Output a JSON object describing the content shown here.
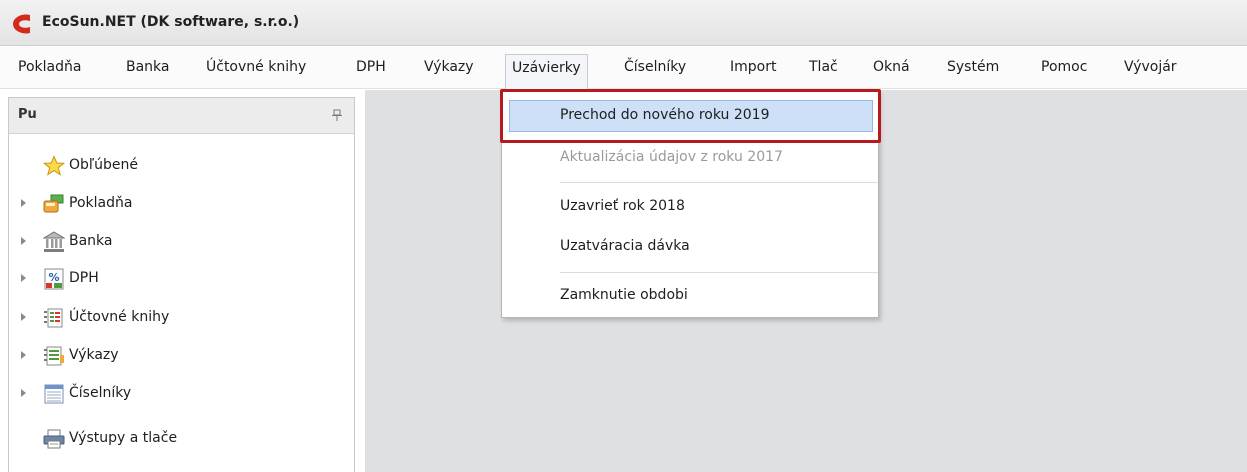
{
  "window": {
    "title": "EcoSun.NET  (DK software, s.r.o.)"
  },
  "menubar": {
    "items": [
      {
        "id": "pokladna",
        "label": "Pokladňa"
      },
      {
        "id": "banka",
        "label": "Banka"
      },
      {
        "id": "uctovne-knihy",
        "label": "Účtovné knihy"
      },
      {
        "id": "dph",
        "label": "DPH"
      },
      {
        "id": "vykazy",
        "label": "Výkazy"
      },
      {
        "id": "uzavierky",
        "label": "Uzávierky"
      },
      {
        "id": "ciselniky",
        "label": "Číselníky"
      },
      {
        "id": "import",
        "label": "Import"
      },
      {
        "id": "tlac",
        "label": "Tlač"
      },
      {
        "id": "okna",
        "label": "Okná"
      },
      {
        "id": "system",
        "label": "Systém"
      },
      {
        "id": "pomoc",
        "label": "Pomoc"
      },
      {
        "id": "vyvojar",
        "label": "Vývojár"
      }
    ],
    "active": "Uzávierky"
  },
  "nav_panel": {
    "title": "Pu",
    "items": [
      {
        "label": "Obľúbené",
        "icon": "star-icon",
        "expandable": false
      },
      {
        "label": "Pokladňa",
        "icon": "cash-register-icon",
        "expandable": true
      },
      {
        "label": "Banka",
        "icon": "bank-icon",
        "expandable": true
      },
      {
        "label": "DPH",
        "icon": "percent-icon",
        "expandable": true
      },
      {
        "label": "Účtovné knihy",
        "icon": "ledger-icon",
        "expandable": true
      },
      {
        "label": "Výkazy",
        "icon": "report-icon",
        "expandable": true
      },
      {
        "label": "Číselníky",
        "icon": "list-icon",
        "expandable": true
      },
      {
        "label": "Výstupy a tlače",
        "icon": "printer-icon",
        "expandable": false
      }
    ]
  },
  "dropdown": {
    "items": [
      {
        "label": "Prechod do nového roku 2019",
        "state": "highlighted"
      },
      {
        "label": "Aktualizácia údajov z roku 2017",
        "state": "disabled"
      },
      {
        "label": "Uzavrieť rok 2018",
        "state": "enabled"
      },
      {
        "label": "Uzatváracia dávka",
        "state": "enabled"
      },
      {
        "label": "Zamknutie obdobi",
        "state": "enabled"
      }
    ]
  },
  "colors": {
    "highlight": "#cde0f7",
    "annotation_frame": "#b71a1e",
    "workspace": "#dfe0e2",
    "logo": "#d42a1e"
  }
}
